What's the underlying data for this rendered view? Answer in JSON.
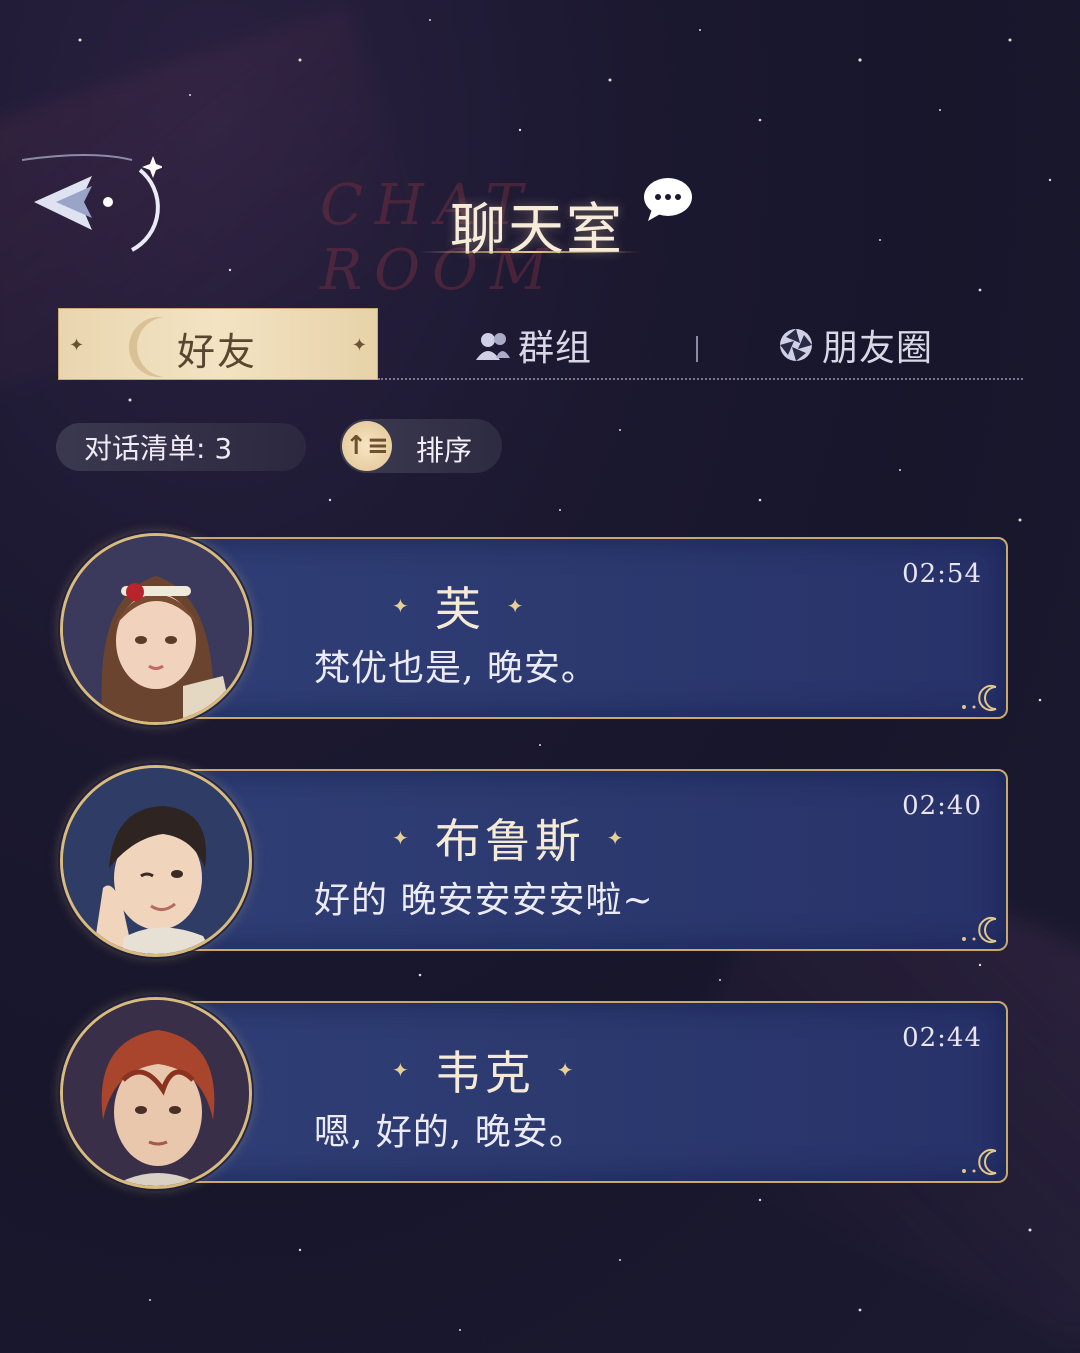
{
  "header": {
    "title": "聊天室",
    "title_bg": "CHAT ROOM"
  },
  "tabs": [
    {
      "label": "好友",
      "active": true
    },
    {
      "label": "群组",
      "icon": "group-icon"
    },
    {
      "label": "朋友圈",
      "icon": "moments-icon"
    }
  ],
  "toolbar": {
    "count_label": "对话清单: 3",
    "sort_label": "排序"
  },
  "chats": [
    {
      "name": "芙",
      "message": "梵优也是, 晚安。",
      "time": "02:54",
      "avatar_color": "#8a5a3c"
    },
    {
      "name": "布鲁斯",
      "message": "好的 晚安安安安啦~",
      "time": "02:40",
      "avatar_color": "#3a2e2a"
    },
    {
      "name": "韦克",
      "message": "嗯, 好的, 晚安。",
      "time": "02:44",
      "avatar_color": "#a8452c"
    }
  ],
  "colors": {
    "background": "#1b1830",
    "card": "#2f3e76",
    "gold": "#c8a86b",
    "tab_active": "#f3e3c2"
  }
}
